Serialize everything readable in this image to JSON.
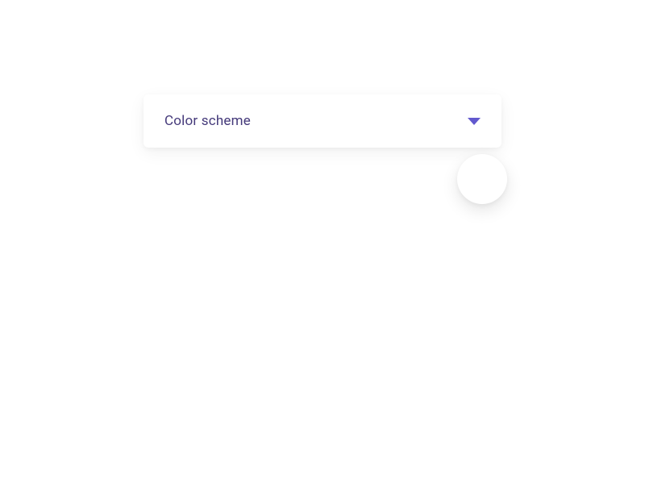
{
  "dropdown": {
    "label": "Color scheme"
  },
  "colors": {
    "text": "#44397a",
    "accent": "#6259ce",
    "background": "#ffffff"
  }
}
